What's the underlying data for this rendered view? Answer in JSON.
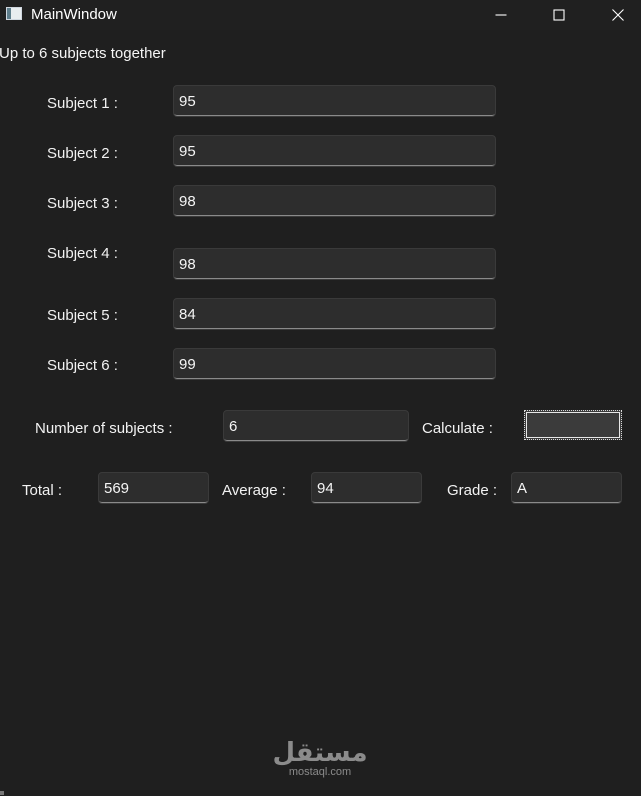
{
  "window": {
    "title": "MainWindow",
    "controls": {
      "minimize": "minimize-icon",
      "maximize": "maximize-icon",
      "close": "close-icon"
    }
  },
  "main": {
    "heading": "Up to 6 subjects together",
    "subjects": [
      {
        "label": "Subject 1 :",
        "value": "95"
      },
      {
        "label": "Subject 2 :",
        "value": "95"
      },
      {
        "label": "Subject 3 :",
        "value": "98"
      },
      {
        "label": "Subject 4 :",
        "value": "98"
      },
      {
        "label": "Subject 5 :",
        "value": "84"
      },
      {
        "label": "Subject 6 :",
        "value": "99"
      }
    ],
    "number_of_subjects": {
      "label": "Number of subjects :",
      "value": "6"
    },
    "calculate": {
      "label": "Calculate :",
      "button_text": ""
    },
    "results": {
      "total": {
        "label": "Total :",
        "value": "569"
      },
      "average": {
        "label": "Average :",
        "value": "94"
      },
      "grade": {
        "label": "Grade :",
        "value": "A"
      }
    }
  },
  "watermark": {
    "logo_text": "مستقل",
    "site": "mostaql.com"
  },
  "colors": {
    "background": "#1f1f1f",
    "field": "#2d2d2d",
    "button": "#3b3b3b",
    "text": "#f2f2f2"
  }
}
